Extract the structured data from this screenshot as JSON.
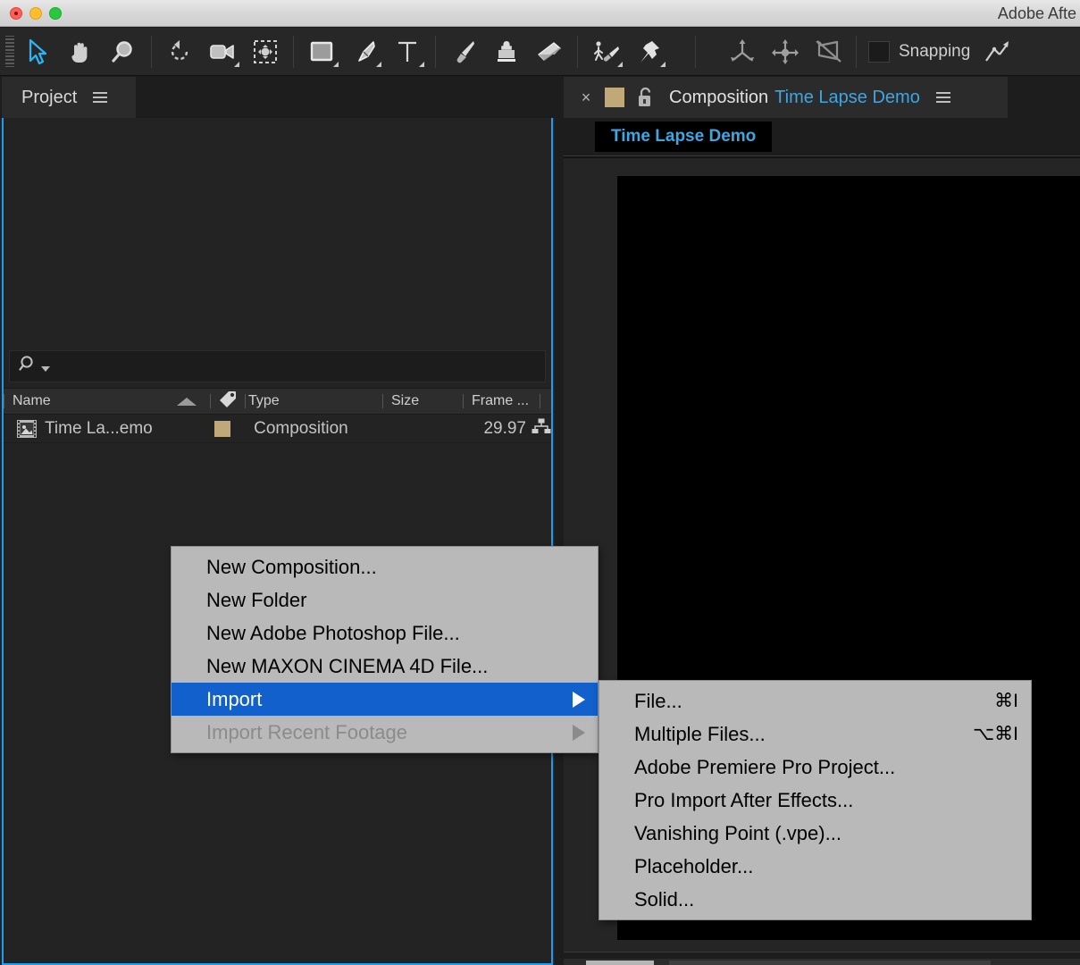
{
  "window": {
    "title": "Adobe Afte",
    "traffic_lights": [
      "close-button",
      "minimize-button",
      "zoom-button"
    ]
  },
  "toolbar": {
    "tools": [
      {
        "name": "selection-tool",
        "icon": "arrow-cursor-icon",
        "active": true,
        "corner": false
      },
      {
        "name": "hand-tool",
        "icon": "hand-icon",
        "active": false,
        "corner": false
      },
      {
        "name": "zoom-tool",
        "icon": "magnifier-icon",
        "active": false,
        "corner": false
      },
      {
        "name": "rotation-tool",
        "icon": "rotate-icon",
        "active": false,
        "corner": false
      },
      {
        "name": "camera-tool",
        "icon": "camera-icon",
        "active": false,
        "corner": true
      },
      {
        "name": "pan-behind-tool",
        "icon": "anchor-point-icon",
        "active": false,
        "corner": false
      },
      {
        "name": "shape-tool",
        "icon": "rectangle-icon",
        "active": false,
        "corner": true
      },
      {
        "name": "pen-tool",
        "icon": "pen-icon",
        "active": false,
        "corner": true
      },
      {
        "name": "type-tool",
        "icon": "text-t-icon",
        "active": false,
        "corner": true
      },
      {
        "name": "brush-tool",
        "icon": "paintbrush-icon",
        "active": false,
        "corner": false
      },
      {
        "name": "clone-stamp-tool",
        "icon": "clone-stamp-icon",
        "active": false,
        "corner": false
      },
      {
        "name": "eraser-tool",
        "icon": "eraser-icon",
        "active": false,
        "corner": false
      },
      {
        "name": "roto-brush-tool",
        "icon": "roto-brush-icon",
        "active": false,
        "corner": true
      },
      {
        "name": "puppet-pin-tool",
        "icon": "pushpin-icon",
        "active": false,
        "corner": true
      },
      {
        "name": "unified-camera-tool",
        "icon": "axis-arrows-icon",
        "active": false,
        "corner": false
      },
      {
        "name": "orbit-camera-tool",
        "icon": "orbit-camera-icon",
        "active": false,
        "corner": false
      },
      {
        "name": "track-camera-tool",
        "icon": "track-camera-icon",
        "active": false,
        "corner": false
      }
    ],
    "snapping_label": "Snapping",
    "snapping_checked": false,
    "snapping_icon": "snap-magnet-icon"
  },
  "project_panel": {
    "tab_label": "Project",
    "menu_icon": "panel-menu-icon",
    "search": {
      "icon": "search-icon",
      "value": "",
      "placeholder": ""
    },
    "columns": [
      {
        "label": "Name",
        "sorted": "asc"
      },
      {
        "label": "",
        "icon": "label-tag-icon"
      },
      {
        "label": "Type"
      },
      {
        "label": "Size"
      },
      {
        "label": "Frame ..."
      }
    ],
    "items": [
      {
        "icon": "composition-icon",
        "name": "Time La...emo",
        "swatch_color": "#c1a878",
        "type": "Composition",
        "size": "",
        "frame_rate": "29.97",
        "frame_icon": "comp-flowchart-icon"
      }
    ]
  },
  "composition_panel": {
    "tab": {
      "close_icon": "close-icon",
      "swatch_color": "#c1a878",
      "lock_icon": "unlocked-padlock-icon",
      "label": "Composition",
      "comp_name": "Time Lapse Demo",
      "menu_icon": "panel-menu-icon"
    },
    "breadcrumb": "Time Lapse Demo",
    "viewer_background": "#000000"
  },
  "context_menu": {
    "items": [
      {
        "label": "New Composition...",
        "state": "normal",
        "submenu": false
      },
      {
        "label": "New Folder",
        "state": "normal",
        "submenu": false
      },
      {
        "label": "New Adobe Photoshop File...",
        "state": "normal",
        "submenu": false
      },
      {
        "label": "New MAXON CINEMA 4D File...",
        "state": "normal",
        "submenu": false
      },
      {
        "label": "Import",
        "state": "selected",
        "submenu": true
      },
      {
        "label": "Import Recent Footage",
        "state": "disabled",
        "submenu": true
      }
    ]
  },
  "import_submenu": {
    "items": [
      {
        "label": "File...",
        "shortcut": "⌘I"
      },
      {
        "label": "Multiple Files...",
        "shortcut": "⌥⌘I"
      },
      {
        "label": "Adobe Premiere Pro Project...",
        "shortcut": ""
      },
      {
        "label": "Pro Import After Effects...",
        "shortcut": ""
      },
      {
        "label": "Vanishing Point (.vpe)...",
        "shortcut": ""
      },
      {
        "label": "Placeholder...",
        "shortcut": ""
      },
      {
        "label": "Solid...",
        "shortcut": ""
      }
    ]
  },
  "colors": {
    "accent_blue": "#2196f3",
    "link_blue": "#3ea6e0",
    "menu_highlight": "#1260cc",
    "swatch_tan": "#c1a878",
    "panel_bg": "#232323"
  }
}
